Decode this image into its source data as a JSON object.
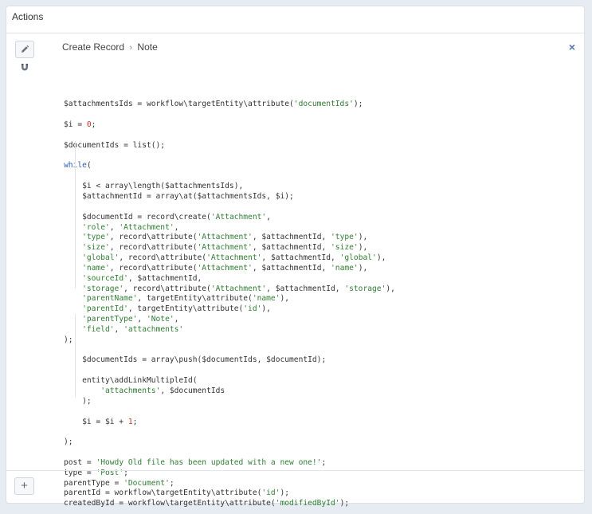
{
  "panel": {
    "title": "Actions"
  },
  "action": {
    "edit_icon": "pencil-icon",
    "magnet_icon": "magnet-icon",
    "breadcrumb": [
      "Create Record",
      "Note"
    ],
    "breadcrumb_separator": "›",
    "close_icon": "×"
  },
  "code_lines": [
    [
      [
        "$attachmentsIds = workflow\\targetEntity\\attribute(",
        ""
      ],
      [
        "'documentIds'",
        "s"
      ],
      [
        ");",
        ""
      ]
    ],
    [],
    [
      [
        "$i = ",
        ""
      ],
      [
        "0",
        "n"
      ],
      [
        ";",
        ""
      ]
    ],
    [],
    [
      [
        "$documentIds = list();",
        ""
      ]
    ],
    [],
    [
      [
        "while",
        "k"
      ],
      [
        "(",
        ""
      ]
    ],
    [],
    [
      [
        "    $i < array\\length($attachmentsIds),",
        ""
      ]
    ],
    [
      [
        "    $attachmentId = array\\at($attachmentsIds, $i);",
        ""
      ]
    ],
    [],
    [
      [
        "    $documentId = record\\create(",
        ""
      ],
      [
        "'Attachment'",
        "s"
      ],
      [
        ",",
        ""
      ]
    ],
    [
      [
        "    ",
        ""
      ],
      [
        "'role'",
        "s"
      ],
      [
        ", ",
        ""
      ],
      [
        "'Attachment'",
        "s"
      ],
      [
        ",",
        ""
      ]
    ],
    [
      [
        "    ",
        ""
      ],
      [
        "'type'",
        "s"
      ],
      [
        ", record\\attribute(",
        ""
      ],
      [
        "'Attachment'",
        "s"
      ],
      [
        ", $attachmentId, ",
        ""
      ],
      [
        "'type'",
        "s"
      ],
      [
        "),",
        ""
      ]
    ],
    [
      [
        "    ",
        ""
      ],
      [
        "'size'",
        "s"
      ],
      [
        ", record\\attribute(",
        ""
      ],
      [
        "'Attachment'",
        "s"
      ],
      [
        ", $attachmentId, ",
        ""
      ],
      [
        "'size'",
        "s"
      ],
      [
        "),",
        ""
      ]
    ],
    [
      [
        "    ",
        ""
      ],
      [
        "'global'",
        "s"
      ],
      [
        ", record\\attribute(",
        ""
      ],
      [
        "'Attachment'",
        "s"
      ],
      [
        ", $attachmentId, ",
        ""
      ],
      [
        "'global'",
        "s"
      ],
      [
        "),",
        ""
      ]
    ],
    [
      [
        "    ",
        ""
      ],
      [
        "'name'",
        "s"
      ],
      [
        ", record\\attribute(",
        ""
      ],
      [
        "'Attachment'",
        "s"
      ],
      [
        ", $attachmentId, ",
        ""
      ],
      [
        "'name'",
        "s"
      ],
      [
        "),",
        ""
      ]
    ],
    [
      [
        "    ",
        ""
      ],
      [
        "'sourceId'",
        "s"
      ],
      [
        ", $attachmentId,",
        ""
      ]
    ],
    [
      [
        "    ",
        ""
      ],
      [
        "'storage'",
        "s"
      ],
      [
        ", record\\attribute(",
        ""
      ],
      [
        "'Attachment'",
        "s"
      ],
      [
        ", $attachmentId, ",
        ""
      ],
      [
        "'storage'",
        "s"
      ],
      [
        "),",
        ""
      ]
    ],
    [
      [
        "    ",
        ""
      ],
      [
        "'parentName'",
        "s"
      ],
      [
        ", targetEntity\\attribute(",
        ""
      ],
      [
        "'name'",
        "s"
      ],
      [
        "),",
        ""
      ]
    ],
    [
      [
        "    ",
        ""
      ],
      [
        "'parentId'",
        "s"
      ],
      [
        ", targetEntity\\attribute(",
        ""
      ],
      [
        "'id'",
        "s"
      ],
      [
        "),",
        ""
      ]
    ],
    [
      [
        "    ",
        ""
      ],
      [
        "'parentType'",
        "s"
      ],
      [
        ", ",
        ""
      ],
      [
        "'Note'",
        "s"
      ],
      [
        ",",
        ""
      ]
    ],
    [
      [
        "    ",
        ""
      ],
      [
        "'field'",
        "s"
      ],
      [
        ", ",
        ""
      ],
      [
        "'attachments'",
        "s"
      ]
    ],
    [
      [
        ");",
        ""
      ]
    ],
    [],
    [
      [
        "    $documentIds = array\\push($documentIds, $documentId);",
        ""
      ]
    ],
    [],
    [
      [
        "    entity\\addLinkMultipleId(",
        ""
      ]
    ],
    [
      [
        "        ",
        ""
      ],
      [
        "'attachments'",
        "s"
      ],
      [
        ", $documentIds",
        ""
      ]
    ],
    [
      [
        "    );",
        ""
      ]
    ],
    [],
    [
      [
        "    $i = $i + ",
        ""
      ],
      [
        "1",
        "n"
      ],
      [
        ";",
        ""
      ]
    ],
    [],
    [
      [
        ");",
        ""
      ]
    ],
    [],
    [
      [
        "post = ",
        ""
      ],
      [
        "'Howdy Old file has been updated with a new one!'",
        "s"
      ],
      [
        ";",
        ""
      ]
    ],
    [
      [
        "type = ",
        ""
      ],
      [
        "'Post'",
        "s"
      ],
      [
        ";",
        ""
      ]
    ],
    [
      [
        "parentType = ",
        ""
      ],
      [
        "'Document'",
        "s"
      ],
      [
        ";",
        ""
      ]
    ],
    [
      [
        "parentId = workflow\\targetEntity\\attribute(",
        ""
      ],
      [
        "'id'",
        "s"
      ],
      [
        ");",
        ""
      ]
    ],
    [
      [
        "createdById = workflow\\targetEntity\\attribute(",
        ""
      ],
      [
        "'modifiedById'",
        "s"
      ],
      [
        ");",
        ""
      ]
    ]
  ],
  "footer": {
    "add_label": "+"
  }
}
